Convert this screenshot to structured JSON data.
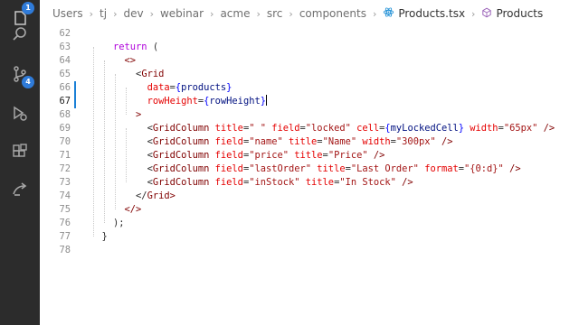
{
  "activity_bar": {
    "explorer_badge": "1",
    "scm_badge": "4"
  },
  "breadcrumb": {
    "items": [
      "Users",
      "tj",
      "dev",
      "webinar",
      "acme",
      "src",
      "components"
    ],
    "file": "Products.tsx",
    "symbol": "Products"
  },
  "editor": {
    "lines": [
      {
        "n": "62",
        "code": ""
      },
      {
        "n": "63",
        "code": "    return ("
      },
      {
        "n": "64",
        "code": "      <>"
      },
      {
        "n": "65",
        "code": "        <Grid"
      },
      {
        "n": "66",
        "code": "          data={products}"
      },
      {
        "n": "67",
        "code": "          rowHeight={rowHeight}"
      },
      {
        "n": "68",
        "code": "        >"
      },
      {
        "n": "69",
        "code": "          <GridColumn title=\" \" field=\"locked\" cell={myLockedCell} width=\"65px\" />"
      },
      {
        "n": "70",
        "code": "          <GridColumn field=\"name\" title=\"Name\" width=\"300px\" />"
      },
      {
        "n": "71",
        "code": "          <GridColumn field=\"price\" title=\"Price\" />"
      },
      {
        "n": "72",
        "code": "          <GridColumn field=\"lastOrder\" title=\"Last Order\" format=\"{0:d}\" />"
      },
      {
        "n": "73",
        "code": "          <GridColumn field=\"inStock\" title=\"In Stock\" />"
      },
      {
        "n": "74",
        "code": "        </Grid>"
      },
      {
        "n": "75",
        "code": "      </>"
      },
      {
        "n": "76",
        "code": "    );"
      },
      {
        "n": "77",
        "code": "  }"
      },
      {
        "n": "78",
        "code": ""
      }
    ],
    "active_line": "67"
  }
}
